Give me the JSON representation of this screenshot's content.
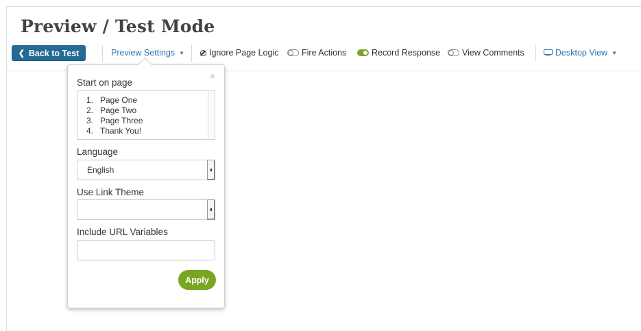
{
  "page": {
    "title": "Preview / Test Mode"
  },
  "toolbar": {
    "back_label": "Back to Test",
    "preview_settings_label": "Preview Settings",
    "ignore_page_logic_label": "Ignore Page Logic",
    "fire_actions_label": "Fire Actions",
    "fire_actions_on": false,
    "record_response_label": "Record Response",
    "record_response_on": true,
    "view_comments_label": "View Comments",
    "view_comments_on": false,
    "desktop_view_label": "Desktop View"
  },
  "icons": {
    "back": "chevron-left-icon",
    "dropdown": "caret-down-icon",
    "ignore": "ban-icon",
    "toggle": "toggle-icon",
    "device": "monitor-icon",
    "close": "close-icon"
  },
  "popover": {
    "close_symbol": "×",
    "start_on_page_label": "Start on page",
    "pages": [
      {
        "num": "1.",
        "label": "Page One"
      },
      {
        "num": "2.",
        "label": "Page Two"
      },
      {
        "num": "3.",
        "label": "Page Three"
      },
      {
        "num": "4.",
        "label": "Thank You!"
      }
    ],
    "language_label": "Language",
    "language_value": "English",
    "link_theme_label": "Use Link Theme",
    "link_theme_value": "",
    "url_vars_label": "Include URL Variables",
    "url_vars_value": "",
    "apply_label": "Apply"
  },
  "colors": {
    "primary_button": "#236b94",
    "link": "#2f76b2",
    "apply_green": "#7aa523",
    "toggle_on": "#7aa523",
    "title": "#3f4347"
  }
}
